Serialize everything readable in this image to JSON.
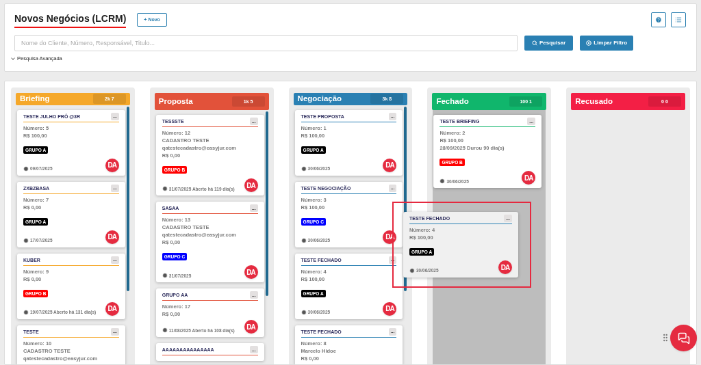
{
  "header": {
    "title": "Novos Negócios (LCRM)",
    "new_button": "+ Novo"
  },
  "search": {
    "placeholder": "Nome do Cliente, Número, Responsável, Titulo...",
    "search_button": "Pesquisar",
    "clear_button": "Limpar Filtro",
    "advanced_link": "Pesquisa Avançada"
  },
  "columns": [
    {
      "title": "Briefing",
      "badge": "2k 7",
      "color": "#f5a82a",
      "drop_target": false,
      "cards": [
        {
          "title": "TESTE JULHO PRÔ @3R",
          "menu": "...",
          "lines": [
            "Número: 5",
            "R$ 100,00"
          ],
          "tag": {
            "label": "GRUPO A",
            "color": "#000000"
          },
          "footer": "09/07/2025",
          "avatar": "DA"
        },
        {
          "title": "ZXBZBASA",
          "menu": "...",
          "lines": [
            "Número: 7",
            "R$ 0,00"
          ],
          "tag": {
            "label": "GRUPO A",
            "color": "#000000"
          },
          "footer": "17/07/2025",
          "avatar": "DA"
        },
        {
          "title": "KUBER",
          "menu": "...",
          "lines": [
            "Número: 9",
            "R$ 0,00"
          ],
          "tag": {
            "label": "GRUPO B",
            "color": "#ff0000"
          },
          "footer": "19/07/2025 Aberto há 131 dia(s)",
          "avatar": "DA"
        },
        {
          "title": "TESTE",
          "menu": "...",
          "lines": [
            "Número: 10",
            "CADASTRO TESTE",
            "qatestecadastro@easyjur.com"
          ]
        }
      ]
    },
    {
      "title": "Proposta",
      "badge": "1k 5",
      "color": "#e2523a",
      "drop_target": false,
      "cards": [
        {
          "title": "TESSSTE",
          "menu": "...",
          "lines": [
            "Número: 12",
            "CADASTRO TESTE",
            "qatestecadastro@easyjur.com",
            "R$ 0,00"
          ],
          "tag": {
            "label": "GRUPO B",
            "color": "#ff0000"
          },
          "footer": "31/07/2025 Aberto há 119 dia(s)",
          "avatar": "DA"
        },
        {
          "title": "SASAA",
          "menu": "...",
          "lines": [
            "Número: 13",
            "CADASTRO TESTE",
            "qatestecadastro@easyjur.com",
            "R$ 0,00"
          ],
          "tag": {
            "label": "GRUPO C",
            "color": "#0000ff"
          },
          "footer": "31/07/2025",
          "avatar": "DA"
        },
        {
          "title": "GRUPO AA",
          "menu": "...",
          "lines": [
            "Número: 17",
            "R$ 0,00"
          ],
          "footer": "11/08/2025 Aberto há 108 dia(s)",
          "avatar": "DA"
        },
        {
          "title": "AAAAAAAAAAAAAAA",
          "menu": "..."
        }
      ]
    },
    {
      "title": "Negociação",
      "badge": "3k 8",
      "color": "#2a80b3",
      "drop_target": false,
      "cards": [
        {
          "title": "TESTE PROPOSTA",
          "menu": "...",
          "lines": [
            "Número: 1",
            "R$ 100,00"
          ],
          "tag": {
            "label": "GRUPO A",
            "color": "#000000"
          },
          "footer": "30/06/2025",
          "avatar": "DA"
        },
        {
          "title": "TESTE NEGOCIAÇÃO",
          "menu": "...",
          "lines": [
            "Número: 3",
            "R$ 100,00"
          ],
          "tag": {
            "label": "GRUPO C",
            "color": "#0000ff"
          },
          "footer": "30/06/2025",
          "avatar": "DA"
        },
        {
          "title": "TESTE FECHADO",
          "menu": "...",
          "lines": [
            "Número: 4",
            "R$ 100,00"
          ],
          "tag": {
            "label": "GRUPO A",
            "color": "#000000"
          },
          "footer": "30/06/2025",
          "avatar": "DA"
        },
        {
          "title": "TESTE FECHADO",
          "menu": "...",
          "lines": [
            "Número: 8",
            "Marcelo Hidoe",
            "R$ 0,00"
          ]
        }
      ]
    },
    {
      "title": "Fechado",
      "badge": "100 1",
      "color": "#10b66c",
      "drop_target": true,
      "cards": [
        {
          "title": "TESTE BRIEFING",
          "menu": "...",
          "lines": [
            "Número: 2",
            "R$ 100,00",
            "28/09/2025 Durou 90 dia(s)"
          ],
          "tag": {
            "label": "GRUPO B",
            "color": "#ff0000"
          },
          "footer": "30/06/2025",
          "avatar": "DA"
        }
      ]
    },
    {
      "title": "Recusado",
      "badge": "0 0",
      "color": "#f31f45",
      "drop_target": false
    }
  ],
  "dragging_card": {
    "title": "TESTE FECHADO",
    "menu": "...",
    "lines": [
      "Número: 4",
      "R$ 100,00"
    ],
    "tag": {
      "label": "GRUPO A",
      "color": "#000000"
    },
    "footer": "30/06/2025",
    "avatar": "DA",
    "color": "#2a80b3"
  }
}
